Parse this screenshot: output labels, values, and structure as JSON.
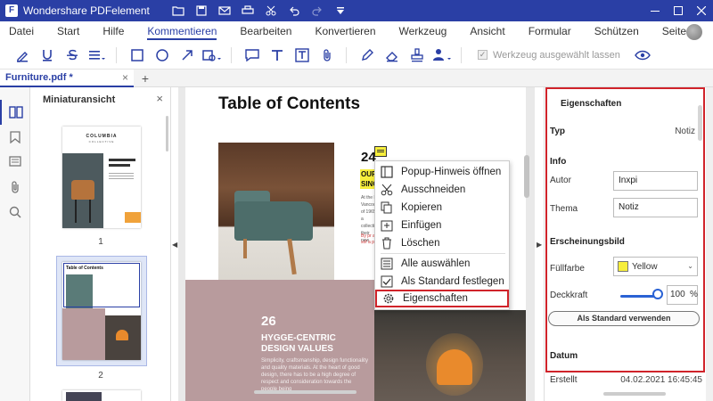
{
  "app": {
    "title": "Wondershare PDFelement",
    "logo_letter": "F"
  },
  "menu": {
    "items": [
      {
        "label": "Datei",
        "active": false
      },
      {
        "label": "Start",
        "active": false
      },
      {
        "label": "Hilfe",
        "active": false
      },
      {
        "label": "Kommentieren",
        "active": true
      },
      {
        "label": "Bearbeiten",
        "active": false
      },
      {
        "label": "Konvertieren",
        "active": false
      },
      {
        "label": "Werkzeug",
        "active": false
      },
      {
        "label": "Ansicht",
        "active": false
      },
      {
        "label": "Formular",
        "active": false
      },
      {
        "label": "Schützen",
        "active": false
      },
      {
        "label": "Seite",
        "active": false
      }
    ]
  },
  "toolbar": {
    "keep_tool_label": "Werkzeug ausgewählt lassen"
  },
  "tab": {
    "label": "Furniture.pdf *",
    "close_glyph": "×",
    "add_glyph": "+"
  },
  "thumbnails": {
    "title": "Miniaturansicht",
    "close_glyph": "×",
    "pages": [
      {
        "number": "1",
        "brand": "COLUMBIA",
        "brand_sub": "COLLECTIVE"
      },
      {
        "number": "2",
        "title": "Table of Contents"
      }
    ]
  },
  "document": {
    "title": "Table of Contents",
    "item24_number": "24",
    "item24_heading": "OUR\nSINC",
    "item24_text": "At the b Vancouve of 1965, a collectio their new",
    "item24_red": "By pr a sof a pr",
    "item26_number": "26",
    "item26_heading": "HYGGE-CENTRIC\nDESIGN VALUES",
    "item26_text": "Simplicity, craftsmanship, design functionality and quality materials. At the heart of good design, there has to be a high degree of respect and consideration towards the people being"
  },
  "context_menu": {
    "items": [
      {
        "label": "Popup-Hinweis öffnen",
        "icon": "popup-note-icon"
      },
      {
        "label": "Ausschneiden",
        "icon": "scissors-icon"
      },
      {
        "label": "Kopieren",
        "icon": "copy-icon"
      },
      {
        "label": "Einfügen",
        "icon": "paste-icon"
      },
      {
        "label": "Löschen",
        "icon": "trash-icon"
      },
      {
        "label": "Alle auswählen",
        "icon": "select-all-icon"
      },
      {
        "label": "Als Standard festlegen",
        "icon": "checkbox-icon"
      },
      {
        "label": "Eigenschaften",
        "icon": "gear-icon",
        "highlighted": true
      }
    ]
  },
  "properties": {
    "title": "Eigenschaften",
    "close_glyph": "›",
    "type_label": "Typ",
    "type_value": "Notiz",
    "info_heading": "Info",
    "author_label": "Autor",
    "author_value": "Inxpi",
    "subject_label": "Thema",
    "subject_value": "Notiz",
    "appearance_heading": "Erscheinungsbild",
    "fill_label": "Füllfarbe",
    "fill_value": "Yellow",
    "fill_color": "#f6ee3c",
    "opacity_label": "Deckkraft",
    "opacity_value": "100",
    "opacity_level": 1.0,
    "opacity_unit": "%",
    "default_button": "Als Standard verwenden",
    "date_heading": "Datum",
    "created_label": "Erstellt",
    "created_value": "04.02.2021 16:45:45"
  },
  "colors": {
    "brand_blue": "#2a3fa5",
    "highlight_red": "#d0232a",
    "note_yellow": "#f6ee3c"
  }
}
